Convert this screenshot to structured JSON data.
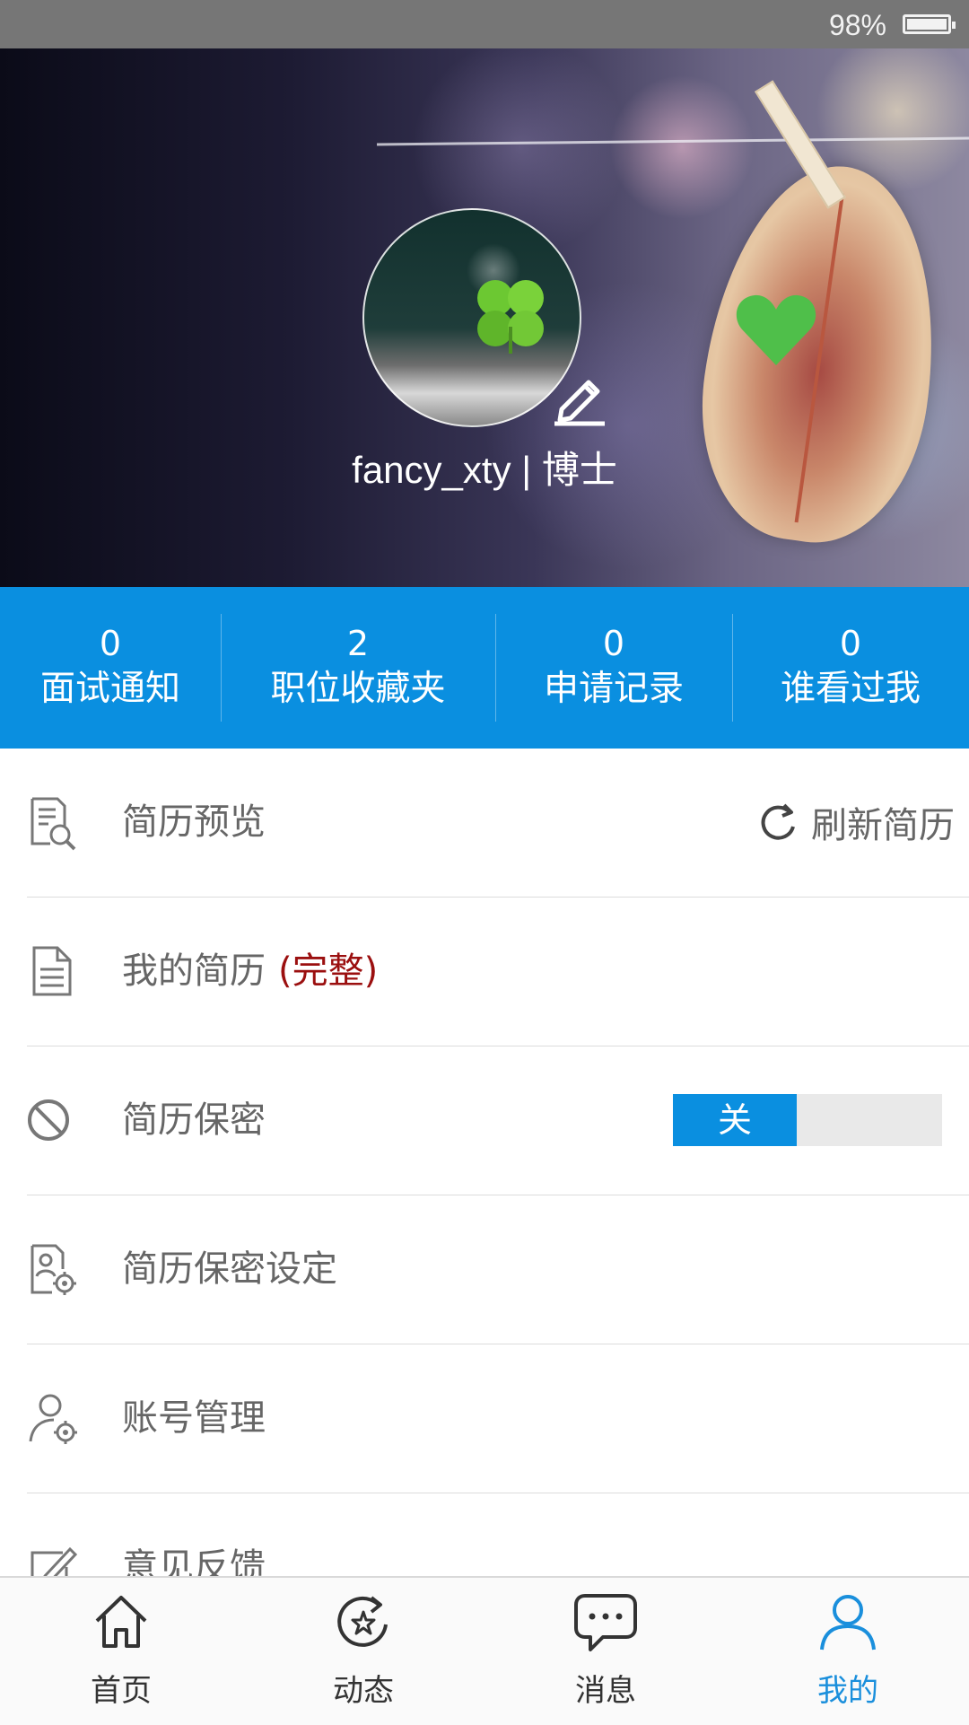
{
  "status_bar": {
    "battery_percent": "98%"
  },
  "profile": {
    "username": "fancy_xty | 博士"
  },
  "stats": [
    {
      "count": "0",
      "label": "面试通知"
    },
    {
      "count": "2",
      "label": "职位收藏夹"
    },
    {
      "count": "0",
      "label": "申请记录"
    },
    {
      "count": "0",
      "label": "谁看过我"
    }
  ],
  "menu": {
    "resume_preview": {
      "label": "简历预览",
      "action": "刷新简历",
      "icon": "resume-preview-icon"
    },
    "my_resume": {
      "label": "我的简历",
      "tag": "(完整)",
      "icon": "document-icon"
    },
    "resume_privacy": {
      "label": "简历保密",
      "toggle_state": "关",
      "icon": "block-icon"
    },
    "privacy_settings": {
      "label": "简历保密设定",
      "icon": "resume-settings-icon"
    },
    "account": {
      "label": "账号管理",
      "icon": "user-settings-icon"
    },
    "feedback": {
      "label": "意见反馈",
      "icon": "edit-icon"
    }
  },
  "bottom_nav": [
    {
      "label": "首页",
      "icon": "home-icon"
    },
    {
      "label": "动态",
      "icon": "star-refresh-icon"
    },
    {
      "label": "消息",
      "icon": "chat-icon"
    },
    {
      "label": "我的",
      "icon": "person-icon",
      "active": true
    }
  ],
  "colors": {
    "accent": "#0a8fe0",
    "tag": "#9b0f0f",
    "active_nav": "#1a8fdc"
  }
}
